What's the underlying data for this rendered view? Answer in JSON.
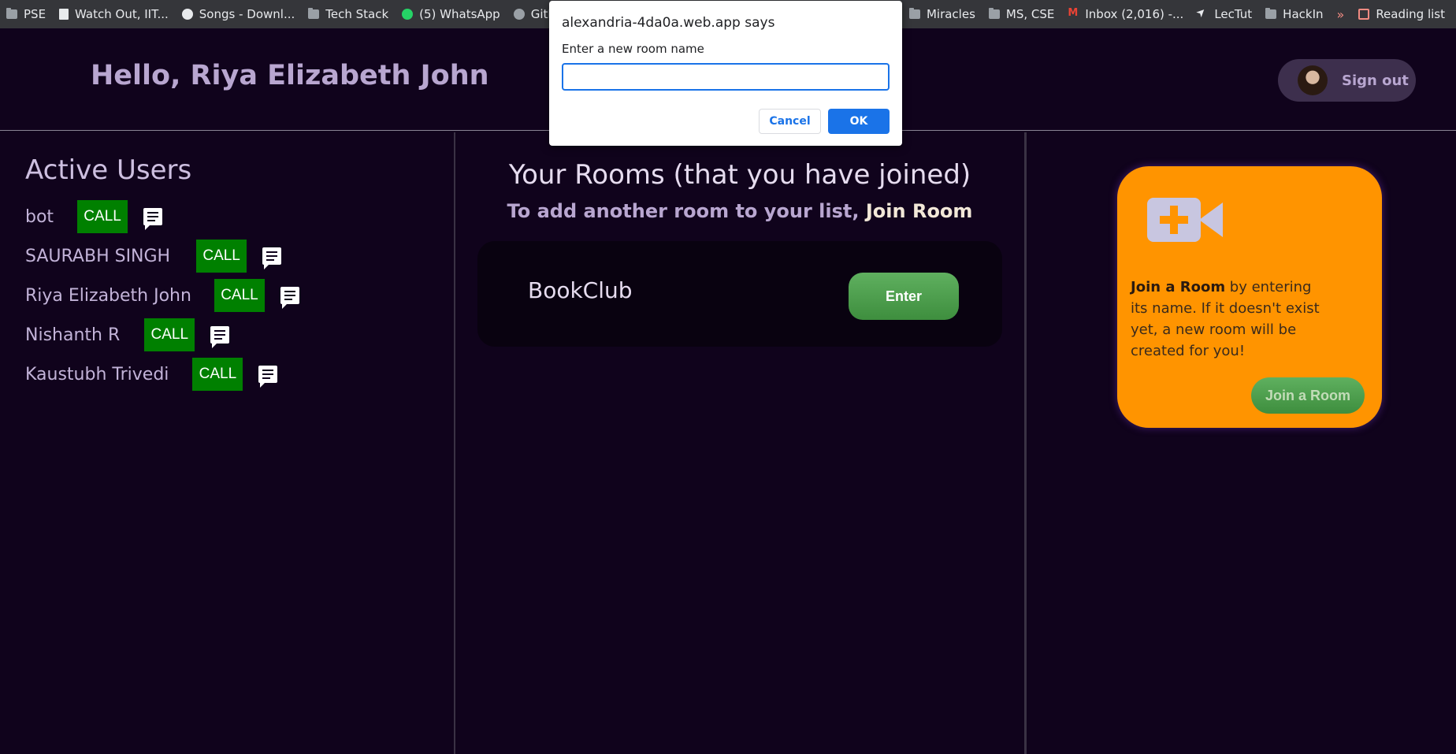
{
  "bookmarks": [
    {
      "label": "PSE",
      "icon": "folder-icon"
    },
    {
      "label": "Watch Out, IIT...",
      "icon": "page-icon"
    },
    {
      "label": "Songs - Downl...",
      "icon": "site-icon"
    },
    {
      "label": "Tech Stack",
      "icon": "folder-icon"
    },
    {
      "label": "(5) WhatsApp",
      "icon": "whatsapp-icon"
    },
    {
      "label": "GitHub",
      "icon": "github-icon"
    }
  ],
  "bookmarks_right": [
    {
      "label": "Miracles",
      "icon": "folder-icon"
    },
    {
      "label": "MS, CSE",
      "icon": "folder-icon"
    },
    {
      "label": "Inbox (2,016) -...",
      "icon": "gmail-icon"
    },
    {
      "label": "LecTut",
      "icon": "send-icon"
    },
    {
      "label": "HackIn",
      "icon": "folder-icon"
    }
  ],
  "overflow_chevron": "»",
  "reading_list": "Reading list",
  "header": {
    "greeting": "Hello, Riya Elizabeth John",
    "signout_label": "Sign out"
  },
  "active_users": {
    "title": "Active Users",
    "call_label": "CALL",
    "users": [
      "bot",
      "SAURABH SINGH",
      "Riya Elizabeth John",
      "Nishanth R",
      "Kaustubh Trivedi"
    ]
  },
  "rooms": {
    "title": "Your Rooms (that you have joined)",
    "subtitle_prefix": "To add another room to your list, ",
    "subtitle_link": "Join Room",
    "items": [
      {
        "name": "BookClub",
        "button": "Enter"
      }
    ]
  },
  "join_card": {
    "bold": "Join a Room",
    "text": " by entering its name. If it doesn't exist yet, a new room will be created for you!",
    "button": "Join a Room",
    "accent": "#ff9400"
  },
  "dialog": {
    "title": "alexandria-4da0a.web.app says",
    "message": "Enter a new room name",
    "input_value": "",
    "cancel": "Cancel",
    "ok": "OK"
  }
}
